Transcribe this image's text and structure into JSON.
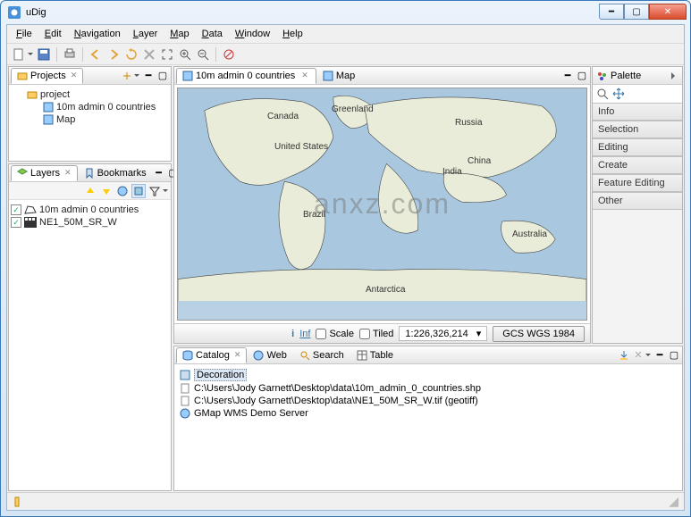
{
  "window": {
    "title": "uDig"
  },
  "menu": {
    "file": "File",
    "edit": "Edit",
    "navigation": "Navigation",
    "layer": "Layer",
    "map": "Map",
    "data": "Data",
    "window": "Window",
    "help": "Help"
  },
  "views": {
    "projects": {
      "title": "Projects",
      "root": "project",
      "item1": "10m admin 0 countries",
      "item2": "Map"
    },
    "layers": {
      "title": "Layers",
      "bookmarks": "Bookmarks",
      "layer1": "10m admin 0 countries",
      "layer2": "NE1_50M_SR_W"
    },
    "catalog": {
      "title": "Catalog",
      "web": "Web",
      "search": "Search",
      "table": "Table",
      "r1": "Decoration",
      "r2": "C:\\Users\\Jody Garnett\\Desktop\\data\\10m_admin_0_countries.shp",
      "r3": "C:\\Users\\Jody Garnett\\Desktop\\data\\NE1_50M_SR_W.tif (geotiff)",
      "r4": "GMap WMS Demo Server"
    }
  },
  "editor": {
    "tab1": "10m admin 0 countries",
    "tab2": "Map"
  },
  "palette": {
    "title": "Palette",
    "d1": "Info",
    "d2": "Selection",
    "d3": "Editing",
    "d4": "Create",
    "d5": "Feature Editing",
    "d6": "Other"
  },
  "status": {
    "info": "Inf",
    "scale": "Scale",
    "tiled": "Tiled",
    "ratio": "1:226,326,214",
    "crs": "GCS WGS 1984"
  },
  "map": {
    "labels": {
      "greenland": "Greenland",
      "canada": "Canada",
      "us": "United States",
      "russia": "Russia",
      "china": "China",
      "india": "India",
      "brazil": "Brazil",
      "australia": "Australia",
      "antarctica": "Antarctica"
    }
  },
  "watermark": "anxz.com"
}
